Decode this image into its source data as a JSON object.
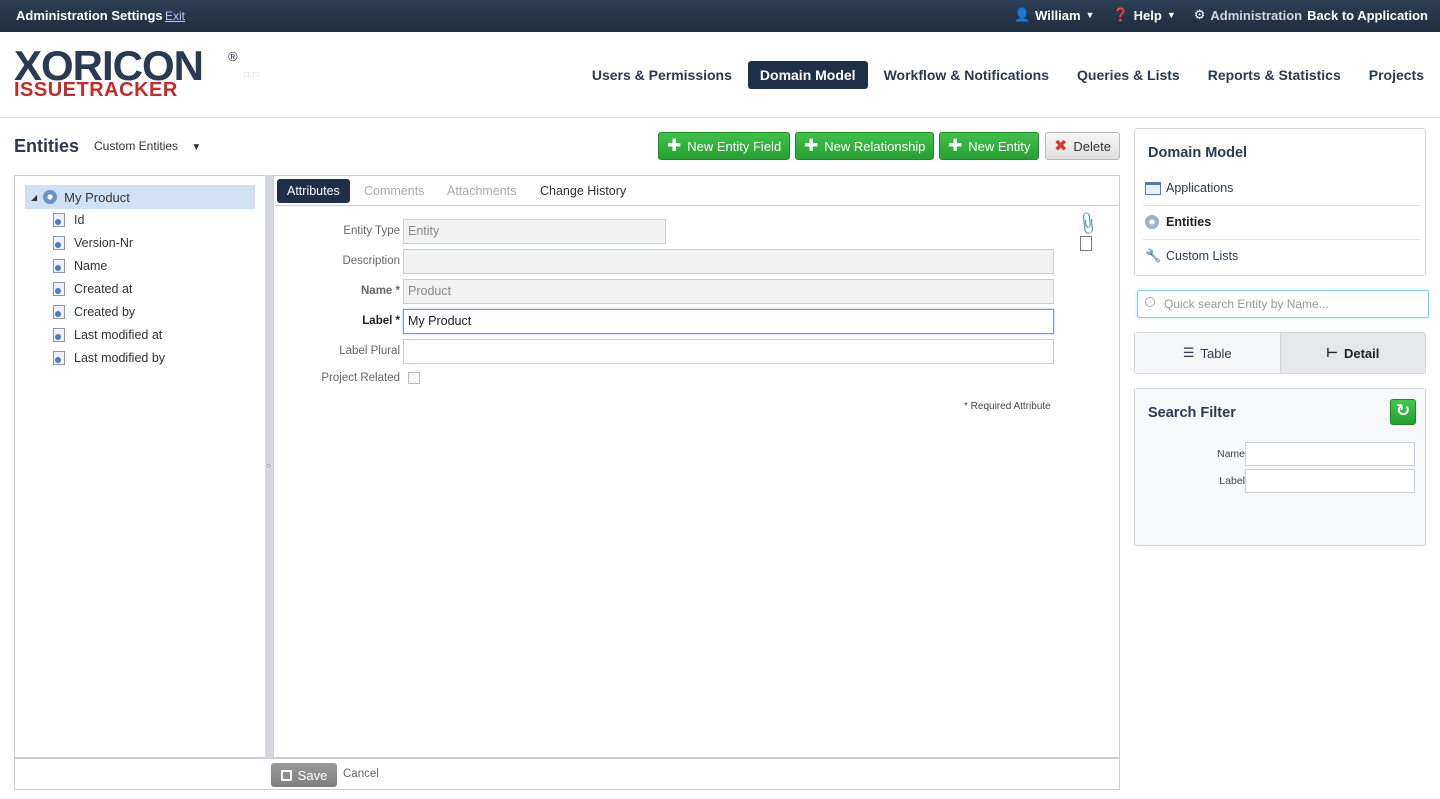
{
  "topbar": {
    "title": "Administration Settings",
    "exit": "Exit",
    "user": "William",
    "help": "Help",
    "admin": "Administration",
    "back": "Back to Application"
  },
  "logo": {
    "line1": "XORICON",
    "line2": "ISSUETRACKER"
  },
  "nav": [
    {
      "label": "Users & Permissions"
    },
    {
      "label": "Domain Model"
    },
    {
      "label": "Workflow & Notifications"
    },
    {
      "label": "Queries & Lists"
    },
    {
      "label": "Reports & Statistics"
    },
    {
      "label": "Projects"
    }
  ],
  "entities": {
    "title": "Entities",
    "select": "Custom Entities"
  },
  "toolbar": {
    "new_field": "New Entity Field",
    "new_relationship": "New Relationship",
    "new_entity": "New Entity",
    "delete": "Delete"
  },
  "tree": {
    "root": "My Product",
    "children": [
      "Id",
      "Version-Nr",
      "Name",
      "Created at",
      "Created by",
      "Last modified at",
      "Last modified by"
    ]
  },
  "tabs": [
    "Attributes",
    "Comments",
    "Attachments",
    "Change History"
  ],
  "form": {
    "entity_type_label": "Entity Type",
    "entity_type_value": "Entity",
    "description_label": "Description",
    "description_value": "",
    "name_label": "Name *",
    "name_value": "Product",
    "label_label": "Label *",
    "label_value": "My Product",
    "label_plural_label": "Label Plural",
    "label_plural_value": "",
    "project_related_label": "Project Related",
    "required_note": "* Required Attribute"
  },
  "bottom": {
    "save": "Save",
    "cancel": "Cancel"
  },
  "sidebar": {
    "title": "Domain Model",
    "items": [
      "Applications",
      "Entities",
      "Custom Lists"
    ],
    "search_placeholder": "Quick search Entity by Name...",
    "view_table": "Table",
    "view_detail": "Detail"
  },
  "filter": {
    "title": "Search Filter",
    "name_label": "Name",
    "label_label": "Label"
  },
  "colors": {
    "topbar": "#1f2d40",
    "accent_green": "#26a031",
    "active_nav": "#1f2f47",
    "logo_red": "#c32a2a"
  }
}
